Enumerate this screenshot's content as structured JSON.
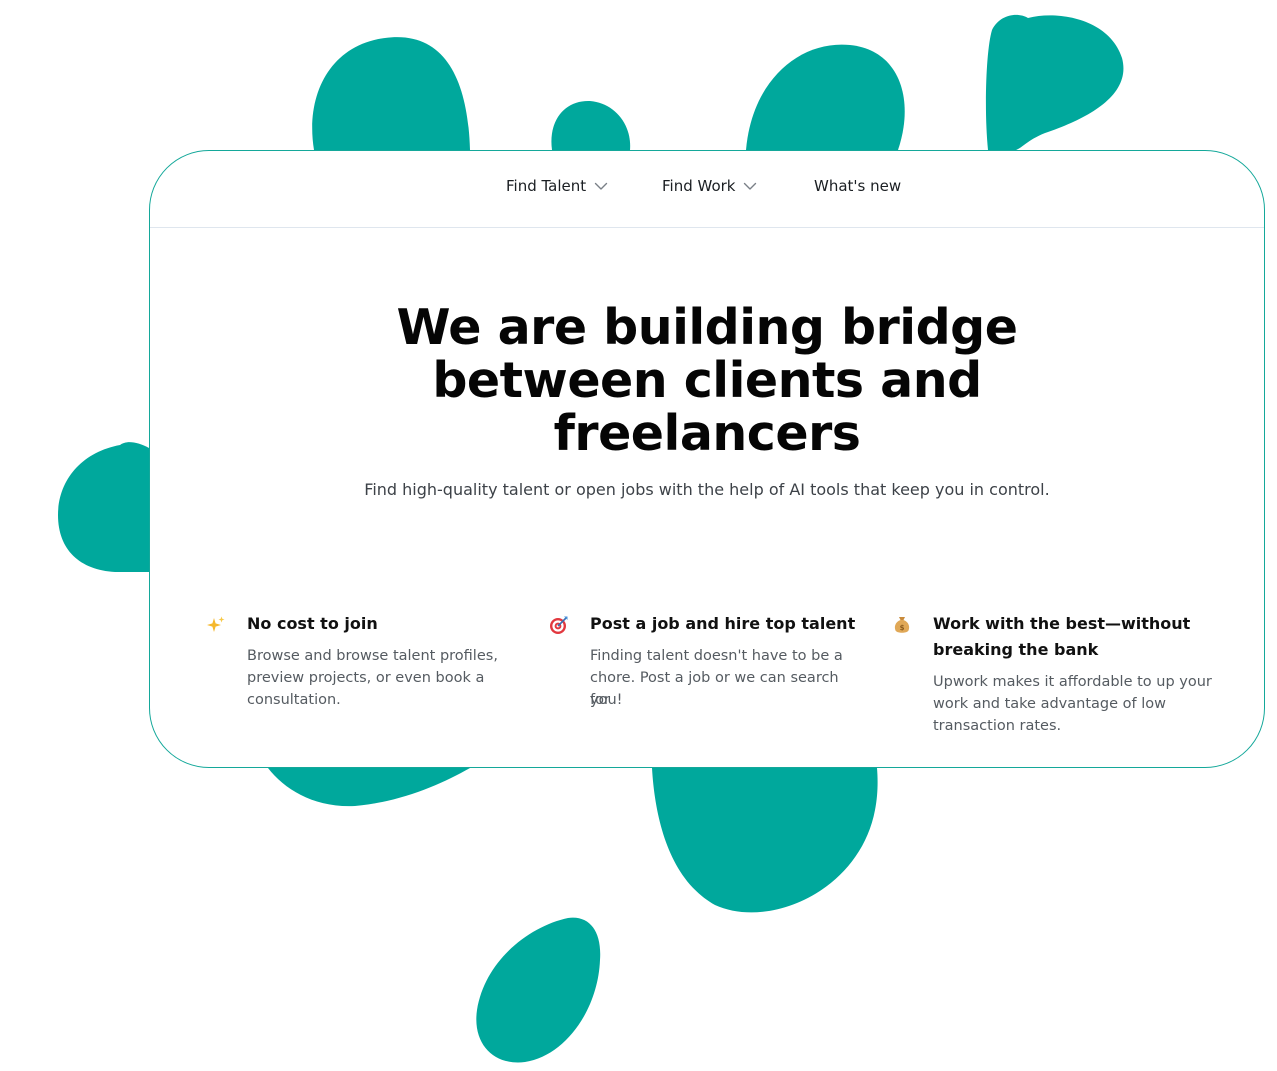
{
  "colors": {
    "accent": "#00a89c",
    "card_border": "#14a89a",
    "divider": "#dfe6ee",
    "title": "#050505",
    "body_text": "#555b61"
  },
  "nav": {
    "items": [
      {
        "label": "Find Talent",
        "icon": "chevron-down-icon"
      },
      {
        "label": "Find Work",
        "icon": "chevron-down-icon"
      },
      {
        "label": "What's new"
      }
    ]
  },
  "hero": {
    "title_lines": [
      "We are building bridge",
      "between clients and",
      "freelancers"
    ],
    "subtitle": "Find high-quality talent or open jobs with the help of AI tools that keep you in control."
  },
  "features": [
    {
      "icon": "sparkles-icon",
      "title_lines": [
        "No cost to join"
      ],
      "desc_lines": [
        "Browse and browse talent profiles,",
        "preview projects, or even book a",
        "consultation."
      ]
    },
    {
      "icon": "target-icon",
      "title_lines": [
        "Post a job and hire top talent"
      ],
      "desc_lines": [
        "Finding talent doesn't have to be a",
        "chore. Post a job or we can search for",
        "you!"
      ]
    },
    {
      "icon": "money-bag-icon",
      "title_lines": [
        "Work with the best—without",
        "breaking the bank"
      ],
      "desc_lines": [
        "Upwork makes it affordable to up your",
        "work and take advantage of low",
        "transaction rates."
      ]
    }
  ]
}
